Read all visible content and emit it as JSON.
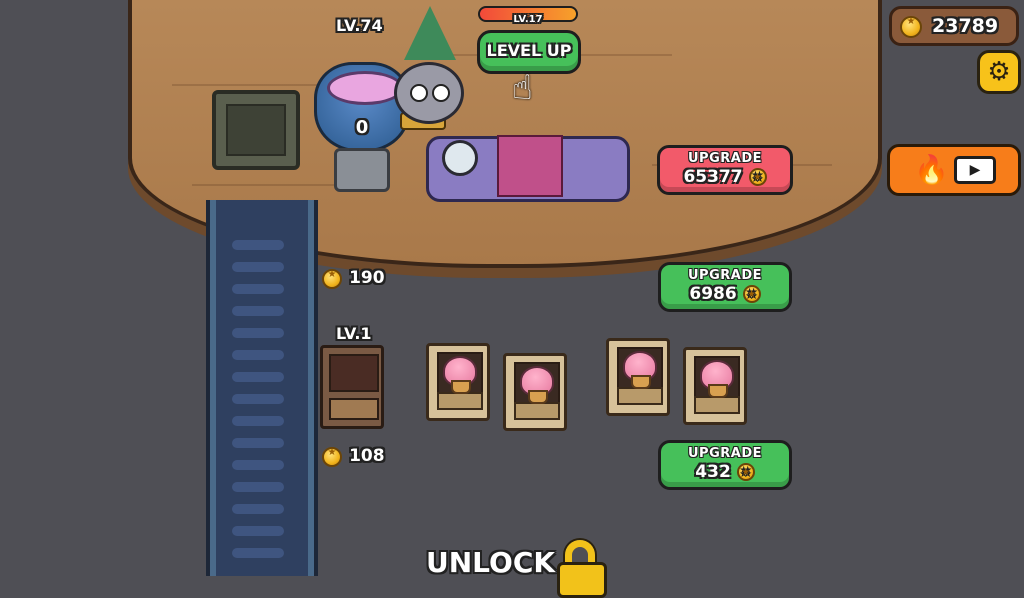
{
  "hud": {
    "coins": "23789"
  },
  "chef": {
    "level_bar_label": "LV.17",
    "level_up_label": "LEVEL UP"
  },
  "cauldron": {
    "level": "LV.74",
    "count": "0"
  },
  "upgrades": [
    {
      "label": "UPGRADE",
      "cost": "65377"
    },
    {
      "label": "UPGRADE",
      "cost": "6986"
    },
    {
      "label": "UPGRADE",
      "cost": "432"
    }
  ],
  "conveyor": {
    "reward_top": "190",
    "reward_bottom": "108"
  },
  "oven": {
    "level": "LV.1"
  },
  "unlock": {
    "label": "UNLOCK"
  },
  "colors": {
    "accent_green": "#46c05a",
    "accent_red": "#f25a6a",
    "boost_orange": "#f77d1a",
    "wood": "#b98a5a"
  },
  "icons": [
    "coin-icon",
    "gear-icon",
    "fire-icon",
    "video-icon",
    "hand-pointer-icon",
    "lock-icon"
  ]
}
